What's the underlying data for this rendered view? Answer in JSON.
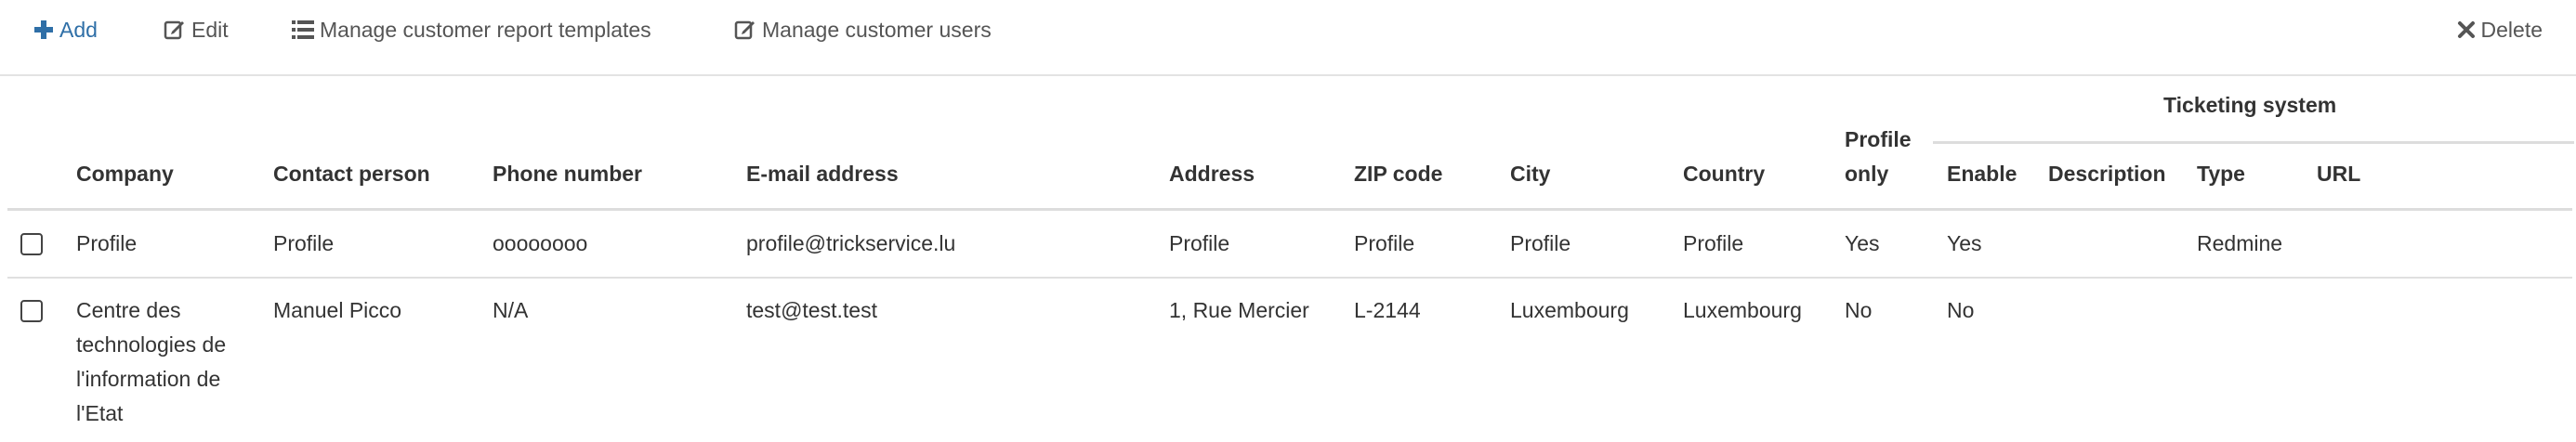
{
  "toolbar": {
    "add_label": "Add",
    "edit_label": "Edit",
    "templates_label": "Manage customer report templates",
    "users_label": "Manage customer users",
    "delete_label": "Delete"
  },
  "table": {
    "group_header": "Ticketing system",
    "columns": {
      "company": "Company",
      "contact": "Contact person",
      "phone": "Phone number",
      "email": "E-mail address",
      "address": "Address",
      "zip": "ZIP code",
      "city": "City",
      "country": "Country",
      "profile_only_1": "Profile",
      "profile_only_2": "only",
      "enable": "Enable",
      "description": "Description",
      "type": "Type",
      "url": "URL"
    },
    "rows": [
      {
        "company": "Profile",
        "contact": "Profile",
        "phone": "oooooooo",
        "email": "profile@trickservice.lu",
        "address": "Profile",
        "zip": "Profile",
        "city": "Profile",
        "country": "Profile",
        "profile_only": "Yes",
        "enable": "Yes",
        "description": "",
        "type": "Redmine",
        "url": ""
      },
      {
        "company_lines": [
          "Centre des",
          "technologies de",
          "l'information de",
          "l'Etat"
        ],
        "contact": "Manuel Picco",
        "phone": "N/A",
        "email": "test@test.test",
        "address": "1, Rue Mercier",
        "zip": "L-2144",
        "city": "Luxembourg",
        "country": "Luxembourg",
        "profile_only": "No",
        "enable": "No",
        "description": "",
        "type": "",
        "url": ""
      }
    ]
  },
  "colors": {
    "accent": "#2f6fa7",
    "text": "#333333",
    "muted": "#555555",
    "rule": "#dddddd"
  },
  "icons": {
    "add": "plus-icon",
    "edit": "edit-icon",
    "templates": "list-icon",
    "users": "edit-icon",
    "delete": "close-icon"
  }
}
